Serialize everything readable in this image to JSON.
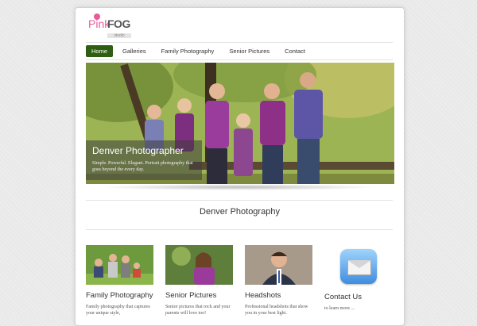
{
  "brand": {
    "logo_pink": "Pink",
    "logo_fog": "FOG",
    "logo_sub": "studio"
  },
  "nav": {
    "items": [
      "Home",
      "Galleries",
      "Family Photography",
      "Senior Pictures",
      "Contact"
    ],
    "active": "Home"
  },
  "hero": {
    "title": "Denver Photographer",
    "description": "Simple. Powerful. Elegant. Portrait photography that goes beyond the every day."
  },
  "section": {
    "title": "Denver Photography"
  },
  "columns": [
    {
      "title": "Family Photography",
      "text": "Family photography that captures your unique style,"
    },
    {
      "title": "Senior Pictures",
      "text": "Senior pictures that rock and your parents will love too!"
    },
    {
      "title": "Headshots",
      "text": "Professional headshots that show you in your best light."
    },
    {
      "title": "Contact Us",
      "text": "to learn more ..."
    }
  ],
  "colors": {
    "nav_active": "#2e5e12",
    "accent_pink": "#e75a9b"
  }
}
